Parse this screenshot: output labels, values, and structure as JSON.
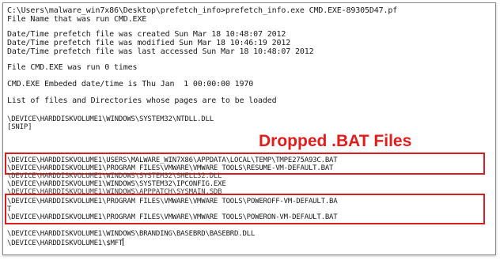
{
  "console": {
    "command_line": "C:\\Users\\malware_win7x86\\Desktop\\prefetch_info>prefetch_info.exe CMD.EXE-89305D47.pf",
    "file_name_line": "File Name that was run CMD.EXE",
    "created_line": "Date/Time prefetch file was created Sun Mar 18 10:48:07 2012",
    "modified_line": "Date/Time prefetch file was modified Sun Mar 18 10:46:19 2012",
    "accessed_line": "Date/Time prefetch file was last accessed Sun Mar 18 10:48:07 2012",
    "run_count_line": "File CMD.EXE was run 0 times",
    "embedded_line": "CMD.EXE Embeded date/time is Thu Jan  1 00:00:00 1970",
    "list_header": "List of files and Directories whose pages are to be loaded",
    "paths": {
      "ntdll": "\\DEVICE\\HARDDISKVOLUME1\\WINDOWS\\SYSTEM32\\NTDLL.DLL",
      "snip": "[SNIP]",
      "tmp_bat": "\\DEVICE\\HARDDISKVOLUME1\\USERS\\MALWARE_WIN7X86\\APPDATA\\LOCAL\\TEMP\\TMPE275A93C.BAT",
      "resume_bat": "\\DEVICE\\HARDDISKVOLUME1\\PROGRAM FILES\\VMWARE\\VMWARE TOOLS\\RESUME-VM-DEFAULT.BAT",
      "cut_line_1": "\\DEVICE\\HARDDISKVOLUME1\\WINDOWS\\SYSTEM32\\SHELL32.DLL",
      "ipconfig": "\\DEVICE\\HARDDISKVOLUME1\\WINDOWS\\SYSTEM32\\IPCONFIG.EXE",
      "cut_line_2": "\\DEVICE\\HARDDISKVOLUME1\\WINDOWS\\APPPATCH\\SYSMAIN.SDB",
      "poweroff_bat": "\\DEVICE\\HARDDISKVOLUME1\\PROGRAM FILES\\VMWARE\\VMWARE TOOLS\\POWEROFF-VM-DEFAULT.BA",
      "poweroff_wrap": "T",
      "poweron_bat": "\\DEVICE\\HARDDISKVOLUME1\\PROGRAM FILES\\VMWARE\\VMWARE TOOLS\\POWERON-VM-DEFAULT.BAT",
      "basebrd": "\\DEVICE\\HARDDISKVOLUME1\\WINDOWS\\BRANDING\\BASEBRD\\BASEBRD.DLL",
      "mft": "\\DEVICE\\HARDDISKVOLUME1\\$MFT"
    }
  },
  "annotation": {
    "label": "Dropped .BAT Files",
    "color": "#e21b1b"
  }
}
